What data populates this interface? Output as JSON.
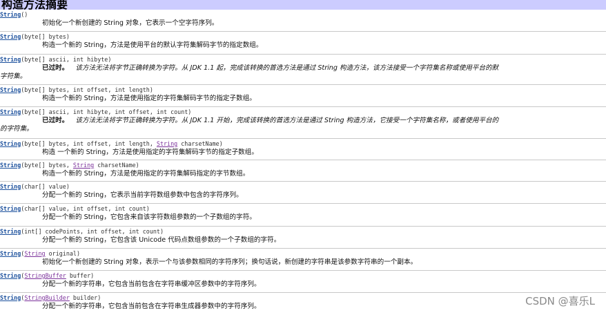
{
  "header": {
    "title": "构造方法摘要"
  },
  "rows": [
    {
      "sig_name": "String",
      "params": "()",
      "desc": "初始化一个新创建的 String 对象，它表示一个空字符序列。"
    },
    {
      "sig_name": "String",
      "params": "(byte[] bytes)",
      "desc": "构造一个新的 String，方法是使用平台的默认字符集解码字节的指定数组。"
    },
    {
      "sig_name": "String",
      "params": "(byte[] ascii, int hibyte)",
      "deprecated_label": "已过时。",
      "desc": "该方法无法将字节正确转换为字符。从 JDK 1.1 起，完成该转换的首选方法是通过 String 构造方法，该方法接受一个字符集名称或使用平台的默",
      "desc_cont": "字符集。"
    },
    {
      "sig_name": "String",
      "params": "(byte[] bytes, int offset, int length)",
      "desc": "构造一个新的 String，方法是使用指定的字符集解码字节的指定子数组。"
    },
    {
      "sig_name": "String",
      "params": "(byte[] ascii, int hibyte, int offset, int count)",
      "deprecated_label": "已过时。",
      "desc": "该方法无法将字节正确转换为字符。从 JDK 1.1 开始，完成该转换的首选方法是通过 String 构造方法，它接受一个字符集名称，或者使用平台的",
      "desc_cont": "的字符集。"
    },
    {
      "sig_name": "String",
      "params_before": "(byte[] bytes, int offset, int length, ",
      "type_link": "String",
      "params_after": " charsetName)",
      "desc": "构造 一个新的 String，方法是使用指定的字符集解码字节的指定子数组。"
    },
    {
      "sig_name": "String",
      "params_before": "(byte[] bytes, ",
      "type_link": "String",
      "params_after": " charsetName)",
      "desc": "构造一个新的 String，方法是使用指定的字符集解码指定的字节数组。"
    },
    {
      "sig_name": "String",
      "params": "(char[] value)",
      "desc": "分配一个新的 String，它表示当前字符数组参数中包含的字符序列。"
    },
    {
      "sig_name": "String",
      "params": "(char[] value, int offset, int count)",
      "desc": "分配一个新的 String，它包含来自该字符数组参数的一个子数组的字符。"
    },
    {
      "sig_name": "String",
      "params": "(int[] codePoints, int offset, int count)",
      "desc": "分配一个新的 String，它包含该 Unicode 代码点数组参数的一个子数组的字符。"
    },
    {
      "sig_name": "String",
      "params_before": "(",
      "type_link": "String",
      "params_after": " original)",
      "desc": "初始化一个新创建的 String 对象，表示一个与该参数相同的字符序列；换句话说，新创建的字符串是该参数字符串的一个副本。"
    },
    {
      "sig_name": "String",
      "params_before": "(",
      "type_link": "StringBuffer",
      "params_after": " buffer)",
      "desc": "分配一个新的字符串，它包含当前包含在字符串缓冲区参数中的字符序列。"
    },
    {
      "sig_name": "String",
      "params_before": "(",
      "type_link": "StringBuilder",
      "params_after": " builder)",
      "desc": "分配一个新的字符串，它包含当前包含在字符串生成器参数中的字符序列。"
    }
  ],
  "watermark": "CSDN @喜乐L"
}
